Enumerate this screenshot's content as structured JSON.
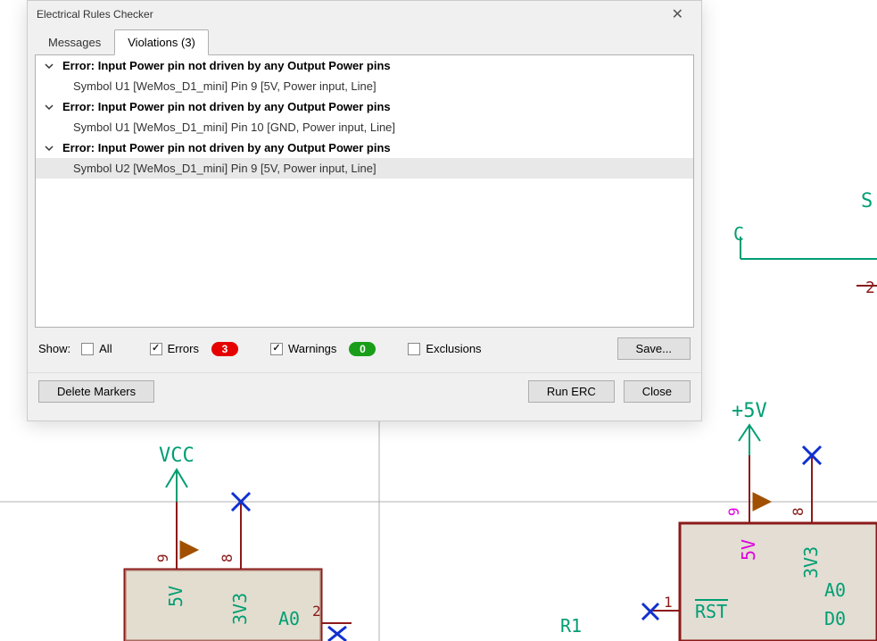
{
  "dialog": {
    "title": "Electrical Rules Checker",
    "tabs": {
      "messages": "Messages",
      "violations": "Violations (3)"
    },
    "violations": [
      {
        "header": "Error: Input Power pin not driven by any Output Power pins",
        "detail": "Symbol U1 [WeMos_D1_mini] Pin 9 [5V, Power input, Line]"
      },
      {
        "header": "Error: Input Power pin not driven by any Output Power pins",
        "detail": "Symbol U1 [WeMos_D1_mini] Pin 10 [GND, Power input, Line]"
      },
      {
        "header": "Error: Input Power pin not driven by any Output Power pins",
        "detail": "Symbol U2 [WeMos_D1_mini] Pin 9 [5V, Power input, Line]"
      }
    ],
    "filters": {
      "show_label": "Show:",
      "all": "All",
      "errors": "Errors",
      "errors_count": "3",
      "warnings": "Warnings",
      "warnings_count": "0",
      "exclusions": "Exclusions",
      "save": "Save..."
    },
    "buttons": {
      "delete_markers": "Delete Markers",
      "run_erc": "Run ERC",
      "close": "Close"
    }
  },
  "schematic": {
    "vcc_label": "VCC",
    "plus5v_label": "+5V",
    "p5v_a": "5V",
    "p3v3_a": "3V3",
    "pin9_a": "9",
    "pin8_a": "8",
    "pin2_a": "2",
    "a0_a": "A0",
    "p5v_b": "5V",
    "p3v3_b": "3V3",
    "pin9_b": "9",
    "pin8_b": "8",
    "pin1_b": "1",
    "pin2_b": "2",
    "rst_b": "RST",
    "a0_b": "A0",
    "d0_b": "D0",
    "s_label": "S",
    "c_label": "C",
    "r1_label": "R1"
  }
}
